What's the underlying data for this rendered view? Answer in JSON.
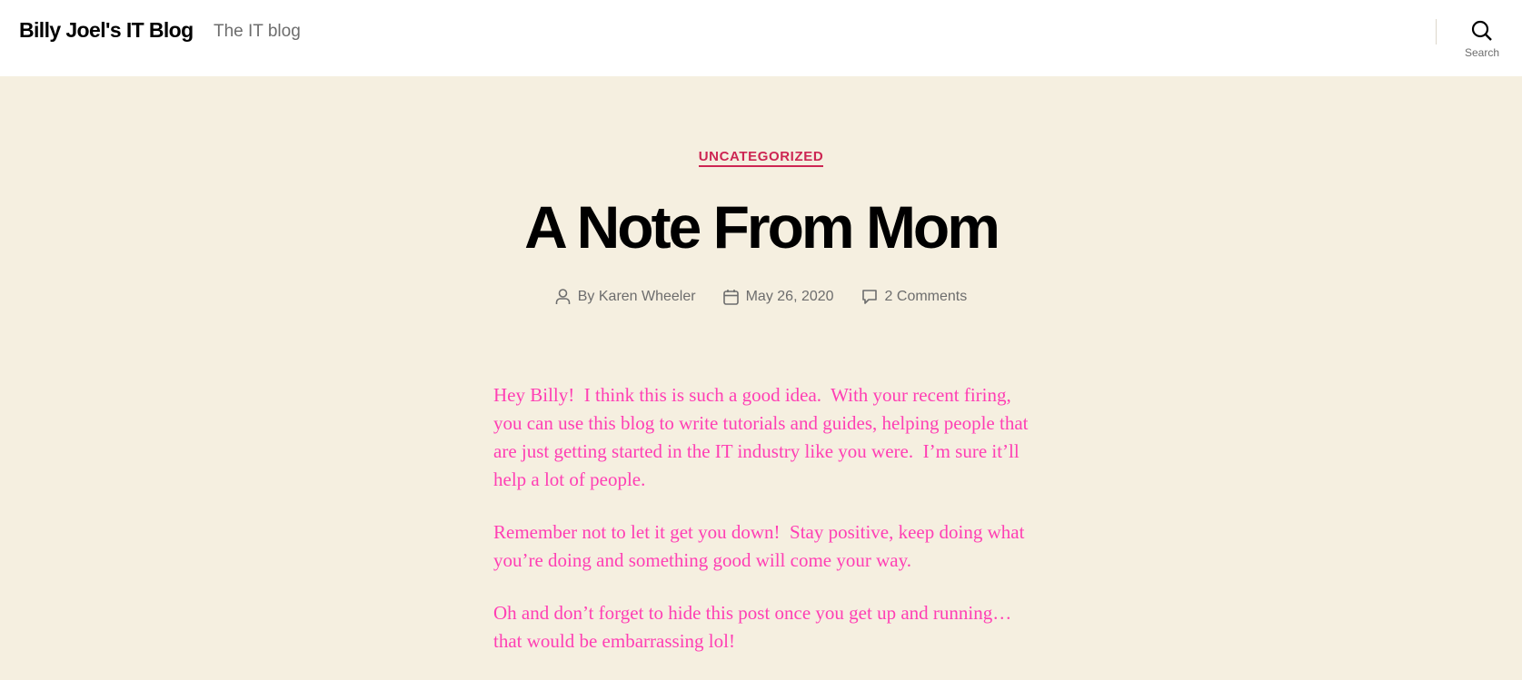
{
  "header": {
    "site_title": "Billy Joel's IT Blog",
    "tagline": "The IT blog",
    "search_label": "Search"
  },
  "post": {
    "category": "UNCATEGORIZED",
    "title": "A Note From Mom",
    "author": "By Karen Wheeler",
    "date": "May 26, 2020",
    "comments": "2 Comments",
    "paragraphs": [
      "Hey Billy!  I think this is such a good idea.  With your recent firing, you can use this blog to write tutorials and guides, helping people that are just getting started in the IT industry like you were.  I’m sure it’ll help a lot of people.",
      "Remember not to let it get you down!  Stay positive, keep doing what you’re doing and something good will come your way.",
      "Oh and don’t forget to hide this post once you get up and running… that would be embarrassing lol!"
    ]
  },
  "colors": {
    "background": "#f5efe0",
    "accent": "#cd2653",
    "body_text": "#ff3fb4"
  }
}
